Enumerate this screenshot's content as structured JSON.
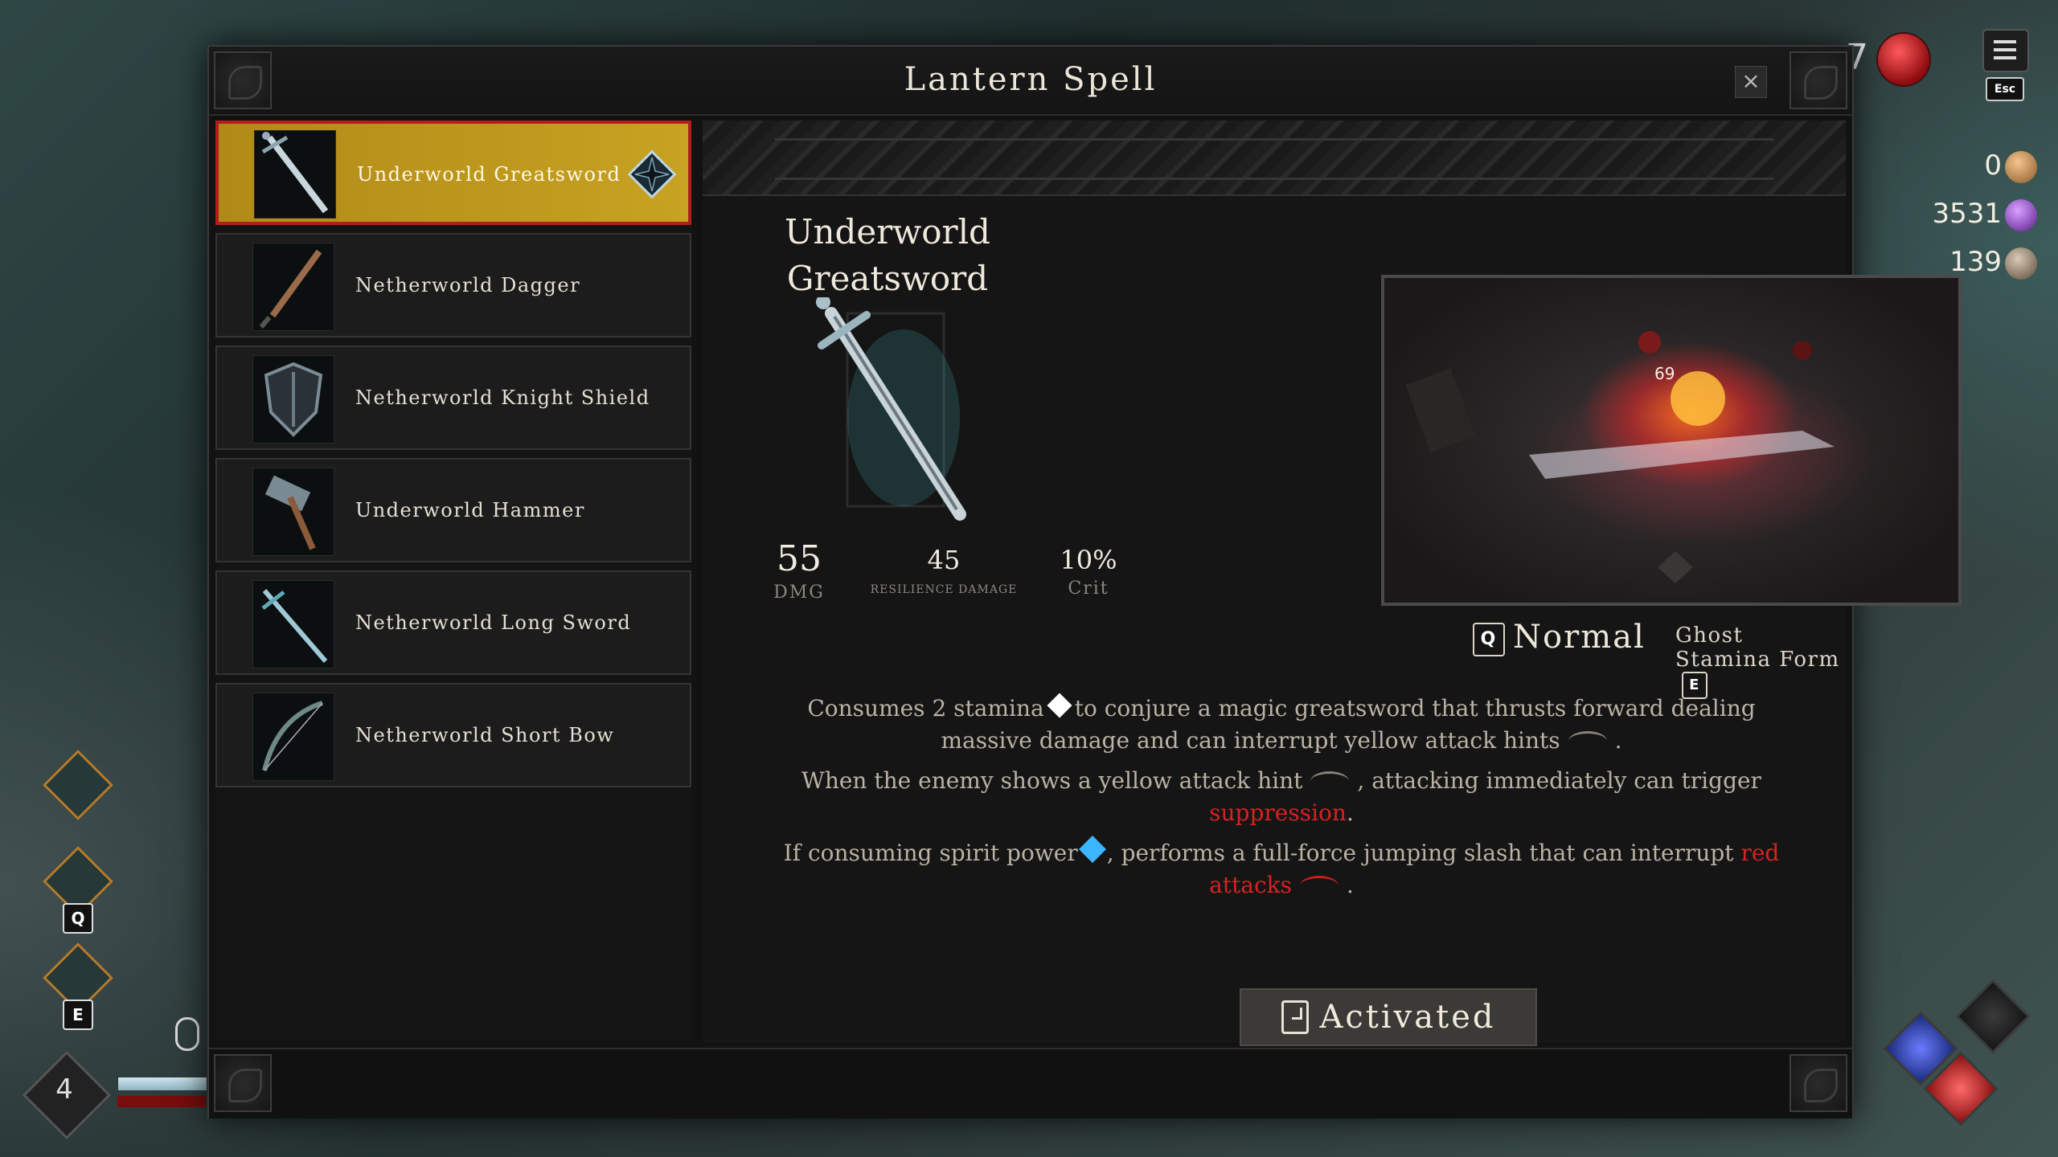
{
  "window": {
    "title": "Lantern Spell",
    "close_glyph": "×"
  },
  "weapons": [
    {
      "label": "Underworld Greatsword",
      "icon": "greatsword-icon",
      "selected": true
    },
    {
      "label": "Netherworld Dagger",
      "icon": "dagger-icon"
    },
    {
      "label": "Netherworld Knight Shield",
      "icon": "shield-icon"
    },
    {
      "label": "Underworld Hammer",
      "icon": "hammer-icon"
    },
    {
      "label": "Netherworld Long Sword",
      "icon": "long-sword-icon"
    },
    {
      "label": "Netherworld Short Bow",
      "icon": "short-bow-icon"
    }
  ],
  "detail": {
    "name": "Underworld Greatsword",
    "stats": {
      "dmg_value": "55",
      "dmg_label": "DMG",
      "res_value": "45",
      "res_label": "Resilience Damage",
      "crit_value": "10%",
      "crit_label": "Crit"
    },
    "preview_damage_number": "69",
    "mode_key": "Q",
    "mode_label": "Normal",
    "alt_mode_label": "Ghost Stamina Form",
    "alt_mode_key": "E",
    "desc1_a": "Consumes 2 stamina",
    "desc1_b": "to conjure a magic greatsword that thrusts forward dealing massive damage and can interrupt yellow attack hints",
    "desc1_c": ".",
    "desc2_a": "When the enemy shows a yellow attack hint",
    "desc2_b": ", attacking immediately can trigger",
    "desc2_red": "suppression",
    "desc2_c": ".",
    "desc3_a": "If consuming spirit power",
    "desc3_b": ", performs a full-force jumping slash that can interrupt",
    "desc3_red": "red attacks",
    "desc3_c": ".",
    "button_label": "Activated"
  },
  "hud": {
    "top_number": "7",
    "menu_key": "Esc",
    "currency_1": "0",
    "currency_2": "3531",
    "currency_3": "139",
    "skill_key_q": "Q",
    "skill_key_e": "E",
    "level": "4"
  },
  "colors": {
    "selected_bg": "#c8a221",
    "selected_border": "#b21e1e",
    "highlight_red": "#d82222",
    "stamina_gem": "#ffffff",
    "spirit_gem": "#3cb6ff"
  }
}
